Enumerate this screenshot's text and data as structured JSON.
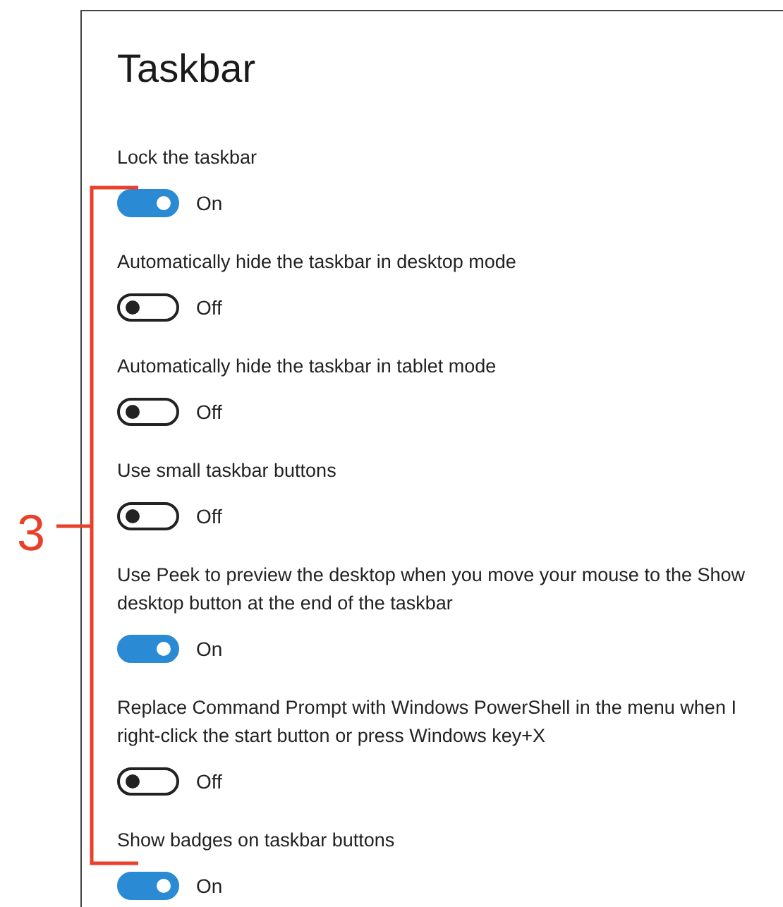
{
  "callout": {
    "number": "3"
  },
  "window": {
    "title": "Taskbar"
  },
  "settings": [
    {
      "label": "Lock the taskbar",
      "on": true,
      "state_text": "On"
    },
    {
      "label": "Automatically hide the taskbar in desktop mode",
      "on": false,
      "state_text": "Off"
    },
    {
      "label": "Automatically hide the taskbar in tablet mode",
      "on": false,
      "state_text": "Off"
    },
    {
      "label": "Use small taskbar buttons",
      "on": false,
      "state_text": "Off"
    },
    {
      "label": "Use Peek to preview the desktop when you move your mouse to the Show desktop button at the end of the taskbar",
      "on": true,
      "state_text": "On"
    },
    {
      "label": "Replace Command Prompt with Windows PowerShell in the menu when I right-click the start button or press Windows key+X",
      "on": false,
      "state_text": "Off"
    },
    {
      "label": "Show badges on taskbar buttons",
      "on": true,
      "state_text": "On"
    }
  ]
}
